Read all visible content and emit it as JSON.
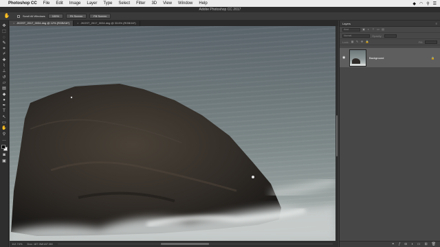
{
  "menubar": {
    "items": [
      "Photoshop CC",
      "File",
      "Edit",
      "Image",
      "Layer",
      "Type",
      "Select",
      "Filter",
      "3D",
      "View",
      "Window",
      "Help"
    ]
  },
  "titlebar": {
    "title": "Adobe Photoshop CC 2017"
  },
  "optionsbar": {
    "scroll_all_windows": "Scroll All Windows",
    "zoom_100": "100%",
    "fit_screen": "Fit Screen",
    "fill_screen": "Fill Screen"
  },
  "tabs": [
    {
      "label": "JKOST_2017_0034.dng @ 12% (RGB/16*)",
      "active": true
    },
    {
      "label": "JKOST_2017_0034.dng @ 33.6% (RGB/16*)",
      "active": false
    }
  ],
  "statusbar": {
    "zoom": "112.74%",
    "doc": "Doc: 187.0M/187.0M"
  },
  "layers_panel": {
    "title": "Layers",
    "kind_label": "Kind",
    "mode": "Normal",
    "opacity_label": "Opacity:",
    "lock_label": "Lock:",
    "fill_label": "Fill:",
    "layer_name": "Background"
  },
  "colors": {
    "foreground": "#000000",
    "background": "#ffffff"
  }
}
